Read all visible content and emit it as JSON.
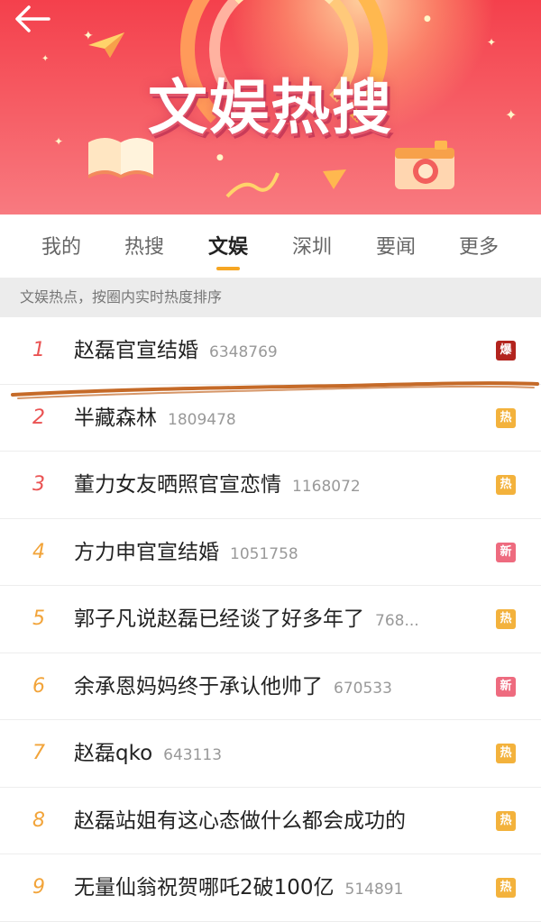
{
  "header": {
    "title": "文娱热搜",
    "back_icon": "back-arrow-icon"
  },
  "tabs": [
    {
      "label": "我的",
      "active": false
    },
    {
      "label": "热搜",
      "active": false
    },
    {
      "label": "文娱",
      "active": true
    },
    {
      "label": "深圳",
      "active": false
    },
    {
      "label": "要闻",
      "active": false
    },
    {
      "label": "更多",
      "active": false
    }
  ],
  "subtitle": "文娱热点，按圈内实时热度排序",
  "colors": {
    "banner": "#f4404c",
    "accent_underline": "#f6a623",
    "rank_top": "#ea5353",
    "rank_low": "#f2a43a",
    "badge_bao": "#b3241e",
    "badge_re": "#f3b23c",
    "badge_xin": "#ee6b7f",
    "scribble": "#c56a28"
  },
  "items": [
    {
      "rank": "1",
      "topic": "赵磊官宣结婚",
      "count": "6348769",
      "badge": "爆"
    },
    {
      "rank": "2",
      "topic": "半藏森林",
      "count": "1809478",
      "badge": "热"
    },
    {
      "rank": "3",
      "topic": "董力女友晒照官宣恋情",
      "count": "1168072",
      "badge": "热"
    },
    {
      "rank": "4",
      "topic": "方力申官宣结婚",
      "count": "1051758",
      "badge": "新"
    },
    {
      "rank": "5",
      "topic": "郭子凡说赵磊已经谈了好多年了",
      "count": "768...",
      "badge": "热"
    },
    {
      "rank": "6",
      "topic": "余承恩妈妈终于承认他帅了",
      "count": "670533",
      "badge": "新"
    },
    {
      "rank": "7",
      "topic": "赵磊qko",
      "count": "643113",
      "badge": "热"
    },
    {
      "rank": "8",
      "topic": "赵磊站姐有这心态做什么都会成功的",
      "count": "",
      "badge": "热"
    },
    {
      "rank": "9",
      "topic": "无量仙翁祝贺哪吒2破100亿",
      "count": "514891",
      "badge": "热"
    }
  ]
}
